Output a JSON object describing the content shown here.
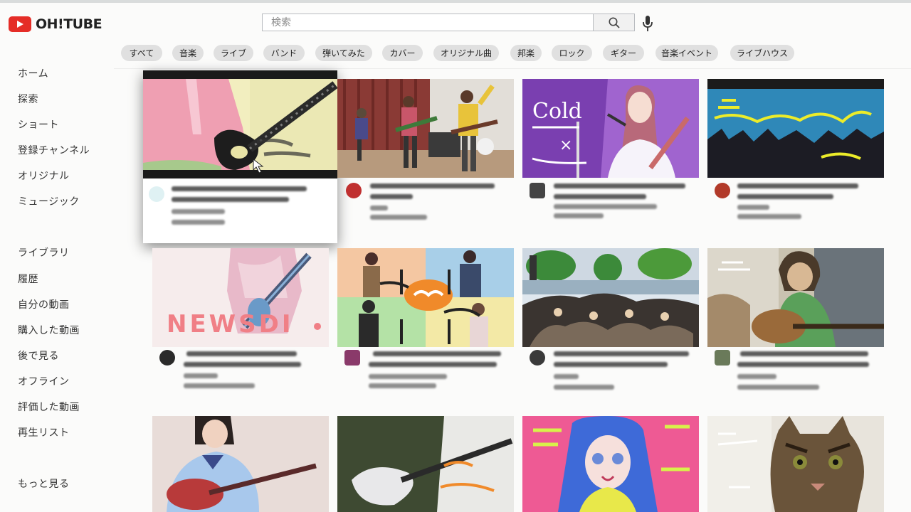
{
  "app": {
    "logo_text": "OH!TUBE"
  },
  "search": {
    "placeholder": "検索"
  },
  "chips": [
    "すべて",
    "音楽",
    "ライブ",
    "バンド",
    "弾いてみた",
    "カバー",
    "オリジナル曲",
    "邦楽",
    "ロック",
    "ギター",
    "音楽イベント",
    "ライブハウス"
  ],
  "sidebar": {
    "main": [
      "ホーム",
      "探索",
      "ショート",
      "登録チャンネル",
      "オリジナル",
      "ミュージック"
    ],
    "library": [
      "ライブラリ",
      "履歴",
      "自分の動画",
      "購入した動画",
      "後で見る",
      "オフライン",
      "評価した動画",
      "再生リスト"
    ],
    "more": "もっと見る"
  },
  "thumb_text": {
    "cold": "Cold",
    "cross": "×",
    "newsdi": "NEWSDI"
  },
  "icons": {
    "logo": "play-icon",
    "search": "search-icon",
    "mic": "microphone-icon",
    "cursor": "mouse-pointer-icon"
  },
  "colors": {
    "brand": "#e52d27",
    "chip_bg": "#e0e0e0",
    "background": "#fbfbfa"
  }
}
